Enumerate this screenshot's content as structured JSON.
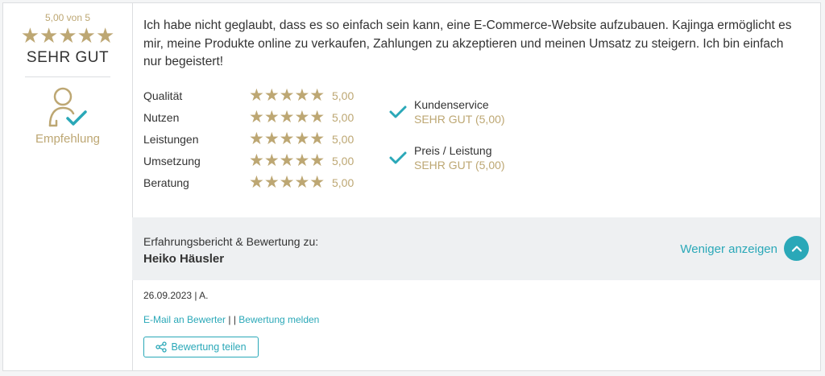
{
  "summary": {
    "score_label": "5,00 von 5",
    "stars": "★★★★★",
    "overall": "SEHR GUT",
    "recommend_label": "Empfehlung"
  },
  "review": {
    "text": "Ich habe nicht geglaubt, dass es so einfach sein kann, eine E-Commerce-Website aufzubauen. Kajinga ermöglicht es mir, meine Produkte online zu verkaufen, Zahlungen zu akzeptieren und meinen Umsatz zu steigern. Ich bin einfach nur begeistert!"
  },
  "ratings": [
    {
      "label": "Qualität",
      "stars": "★★★★★",
      "value": "5,00"
    },
    {
      "label": "Nutzen",
      "stars": "★★★★★",
      "value": "5,00"
    },
    {
      "label": "Leistungen",
      "stars": "★★★★★",
      "value": "5,00"
    },
    {
      "label": "Umsetzung",
      "stars": "★★★★★",
      "value": "5,00"
    },
    {
      "label": "Beratung",
      "stars": "★★★★★",
      "value": "5,00"
    }
  ],
  "checks": [
    {
      "title": "Kundenservice",
      "sub": "SEHR GUT (5,00)"
    },
    {
      "title": "Preis / Leistung",
      "sub": "SEHR GUT (5,00)"
    }
  ],
  "about": {
    "label": "Erfahrungsbericht & Bewertung zu:",
    "name": "Heiko Häusler",
    "less_label": "Weniger anzeigen"
  },
  "meta": {
    "date_author": "26.09.2023 | A.",
    "email_link": "E-Mail an Bewerter",
    "separator": " | | ",
    "report_link": "Bewertung melden",
    "share_label": "Bewertung teilen"
  },
  "colors": {
    "gold": "#bda773",
    "teal": "#2aa8b8",
    "gray_bar": "#eef0f2"
  },
  "icons": [
    "user-check-icon",
    "checkmark-icon",
    "chevron-up-icon",
    "share-icon"
  ]
}
